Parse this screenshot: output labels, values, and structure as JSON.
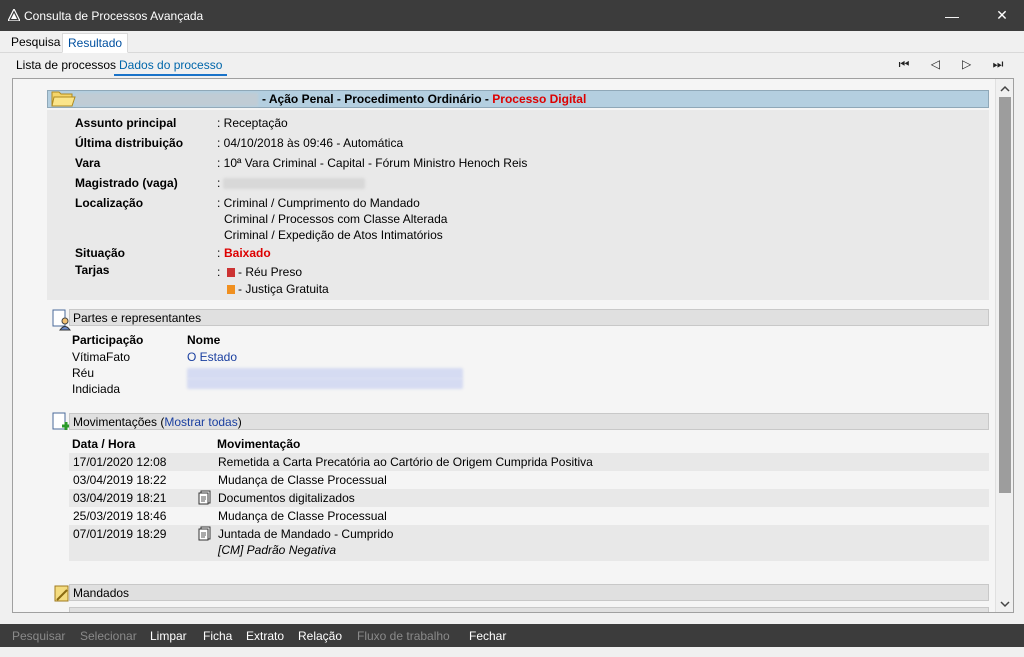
{
  "window": {
    "title": "Consulta de Processos Avançada",
    "minimize": "—",
    "close": "✕"
  },
  "tabs": [
    "Pesquisa",
    "Resultado"
  ],
  "subtabs": [
    "Lista de processos",
    "Dados do processo"
  ],
  "nav": {
    "first": "⏮",
    "prev": "◁",
    "next": "▷",
    "last": "⏭"
  },
  "process": {
    "header_class": "- Ação Penal - Procedimento Ordinário -",
    "header_badge": "Processo Digital",
    "fields": {
      "assunto_label": "Assunto principal",
      "assunto_value": ": Receptação",
      "distribuicao_label": "Última distribuição",
      "distribuicao_value": ": 04/10/2018 às 09:46 - Automática",
      "vara_label": "Vara",
      "vara_value": ": 10ª Vara Criminal - Capital - Fórum Ministro Henoch Reis",
      "magistrado_label": "Magistrado (vaga)",
      "magistrado_value": ":",
      "localizacao_label": "Localização",
      "localizacao_1": ": Criminal / Cumprimento do Mandado",
      "localizacao_2": "Criminal / Processos com Classe Alterada",
      "localizacao_3": "Criminal / Expedição de Atos Intimatórios",
      "situacao_label": "Situação",
      "situacao_prefix": ":",
      "situacao_value": "Baixado",
      "tarjas_label": "Tarjas",
      "tarjas_prefix": ":",
      "tarja_1": "- Réu Preso",
      "tarja_2": "- Justiça Gratuita"
    },
    "colors": {
      "tarja_1": "#cc3333",
      "tarja_2": "#f09020"
    }
  },
  "partes": {
    "title": "Partes e representantes",
    "col_participacao": "Participação",
    "col_nome": "Nome",
    "rows": [
      {
        "participacao": "VítimaFato",
        "nome": "O Estado"
      },
      {
        "participacao": "Réu",
        "nome": ""
      },
      {
        "participacao": "Indiciada",
        "nome": ""
      }
    ]
  },
  "movimentacoes": {
    "title_prefix": "Movimentações (",
    "show_all": "Mostrar todas",
    "title_suffix": ")",
    "col_data": "Data / Hora",
    "col_mov": "Movimentação",
    "rows": [
      {
        "data": "17/01/2020 12:08",
        "mov": "Remetida a Carta Precatória ao Cartório de Origem Cumprida Positiva"
      },
      {
        "data": "03/04/2019 18:22",
        "mov": "Mudança de Classe Processual"
      },
      {
        "data": "03/04/2019 18:21",
        "mov": "Documentos digitalizados"
      },
      {
        "data": "25/03/2019 18:46",
        "mov": "Mudança de Classe Processual"
      },
      {
        "data": "07/01/2019 18:29",
        "mov": "Juntada de Mandado - Cumprido",
        "note": "[CM] Padrão Negativa"
      }
    ]
  },
  "mandados": {
    "title": "Mandados"
  },
  "bottom": {
    "pesquisar": "Pesquisar",
    "selecionar": "Selecionar",
    "limpar": "Limpar",
    "ficha": "Ficha",
    "extrato": "Extrato",
    "relacao": "Relação",
    "fluxo": "Fluxo de trabalho",
    "fechar": "Fechar"
  }
}
